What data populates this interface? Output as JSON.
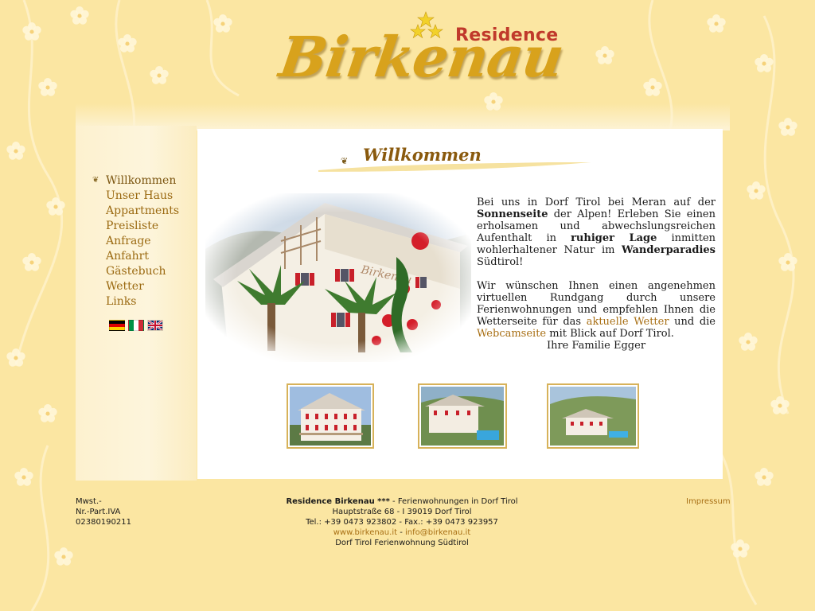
{
  "logo": {
    "residence": "Residence",
    "birkenau": "Birkenau"
  },
  "nav": {
    "items": [
      {
        "label": "Willkommen",
        "active": true
      },
      {
        "label": "Unser Haus"
      },
      {
        "label": "Appartments"
      },
      {
        "label": "Preisliste"
      },
      {
        "label": "Anfrage"
      },
      {
        "label": "Anfahrt"
      },
      {
        "label": "Gästebuch"
      },
      {
        "label": "Wetter"
      },
      {
        "label": "Links"
      }
    ],
    "flags": [
      "german-flag",
      "italian-flag",
      "english-flag"
    ]
  },
  "main": {
    "title": "Willkommen",
    "image_sign": "Residence Birkenau",
    "intro": {
      "p1_a": "Bei uns in Dorf Tirol bei Meran auf der",
      "p1_b": "Sonnenseite",
      "p1_c": "der Alpen! Erleben Sie einen erholsamen und abwechslungsreichen Aufenthalt in",
      "p1_d": "ruhiger Lage",
      "p1_e": "inmitten wohlerhaltener Natur im",
      "p1_f": "Wanderparadies",
      "p1_g": "Südtirol!",
      "p2_a": "Wir wünschen Ihnen einen angenehmen virtuellen Rundgang durch unsere Ferienwohnungen und empfehlen Ihnen die Wetterseite für das",
      "p2_link1": "aktuelle Wetter",
      "p2_b": "und die",
      "p2_link2": "Webcamseite",
      "p2_c": "mit Blick auf Dorf Tirol.",
      "signature": "Ihre Familie Egger"
    }
  },
  "footer": {
    "left": [
      "Mwst.-",
      "Nr.-Part.IVA",
      "02380190211"
    ],
    "company": "Residence Birkenau ***",
    "company_suffix": " - Ferienwohnungen in Dorf Tirol",
    "address": "Hauptstraße 68 - I 39019 Dorf Tirol",
    "phone": "Tel.: +39 0473 923802 - Fax.: +39 0473 923957",
    "web": "www.birkenau.it",
    "sep": " - ",
    "email": "info@birkenau.it",
    "tagline": "Dorf Tirol Ferienwohnung Südtirol",
    "impressum": "Impressum"
  },
  "colors": {
    "background": "#fbe6a2",
    "link": "#a86f14",
    "nav": "#9b6a12",
    "logo_red": "#c0392b",
    "logo_gold": "#d8a21c"
  }
}
